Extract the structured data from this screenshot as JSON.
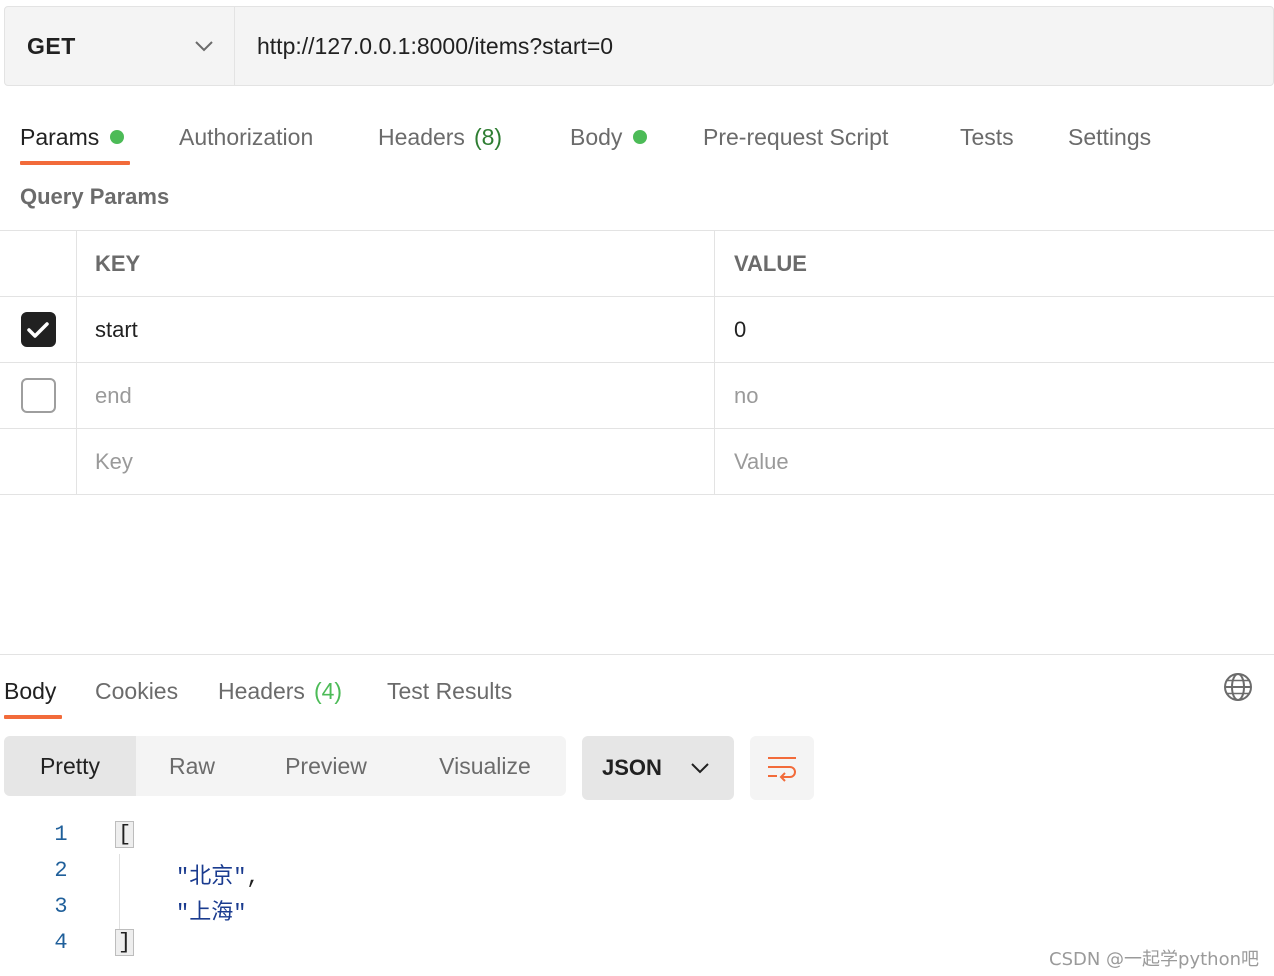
{
  "request": {
    "method": "GET",
    "url": "http://127.0.0.1:8000/items?start=0"
  },
  "request_tabs": [
    {
      "label": "Params",
      "dot": true,
      "active": true
    },
    {
      "label": "Authorization"
    },
    {
      "label": "Headers",
      "count": "(8)"
    },
    {
      "label": "Body",
      "dot": true
    },
    {
      "label": "Pre-request Script"
    },
    {
      "label": "Tests"
    },
    {
      "label": "Settings"
    }
  ],
  "query_params": {
    "title": "Query Params",
    "headers": {
      "key": "KEY",
      "value": "VALUE"
    },
    "rows": [
      {
        "checked": true,
        "key": "start",
        "value": "0"
      },
      {
        "checked": false,
        "key": "end",
        "value": "no"
      }
    ],
    "placeholder": {
      "key": "Key",
      "value": "Value"
    }
  },
  "response_tabs": [
    {
      "label": "Body",
      "active": true
    },
    {
      "label": "Cookies"
    },
    {
      "label": "Headers",
      "count": "(4)"
    },
    {
      "label": "Test Results"
    }
  ],
  "view_modes": [
    "Pretty",
    "Raw",
    "Preview",
    "Visualize"
  ],
  "active_view_mode": "Pretty",
  "format": "JSON",
  "code_lines": [
    {
      "num": "1",
      "text": "["
    },
    {
      "num": "2",
      "text": "\"北京\"",
      "suffix": ","
    },
    {
      "num": "3",
      "text": "\"上海\""
    },
    {
      "num": "4",
      "text": "]"
    }
  ],
  "watermark": "CSDN @一起学python吧",
  "colors": {
    "accent": "#f26b3a",
    "dot": "#4cbb57",
    "count": "#2e7d32",
    "string": "#1a3b8f"
  }
}
